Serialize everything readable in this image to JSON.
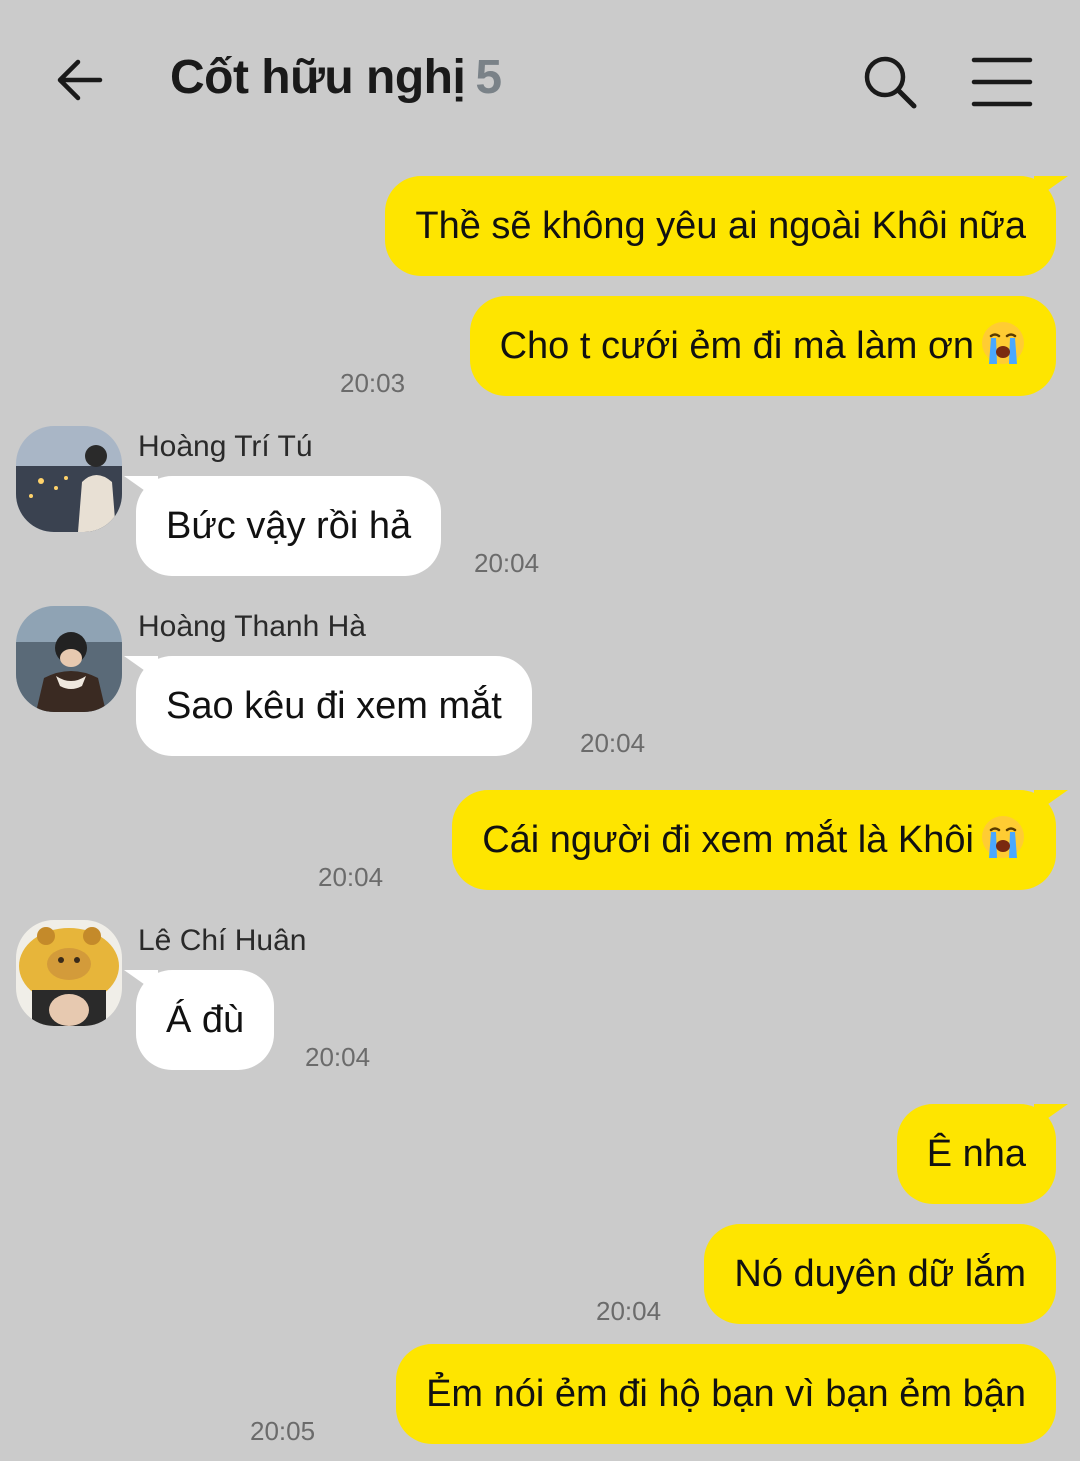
{
  "header": {
    "title": "Cốt hữu nghị",
    "member_count": "5"
  },
  "messages": [
    {
      "text": "Thề sẽ không yêu ai ngoài Khôi nữa"
    },
    {
      "text": "Cho t cưới ẻm đi mà làm ơn",
      "time": "20:03",
      "emoji": "loudly-crying-face"
    },
    {
      "sender": "Hoàng Trí Tú",
      "text": "Bức vậy rồi hả",
      "time": "20:04"
    },
    {
      "sender": "Hoàng Thanh Hà",
      "text": "Sao kêu đi xem mắt",
      "time": "20:04"
    },
    {
      "text": "Cái người đi xem mắt là Khôi",
      "time": "20:04",
      "emoji": "loudly-crying-face"
    },
    {
      "sender": "Lê Chí Huân",
      "text": "Á đù",
      "time": "20:04"
    },
    {
      "text": "Ê nha"
    },
    {
      "text": "Nó duyên dữ lắm",
      "time": "20:04"
    },
    {
      "text": "Ẻm nói ẻm đi hộ bạn vì bạn ẻm bận",
      "time": "20:05"
    }
  ],
  "colors": {
    "background": "#cbcbcb",
    "outgoing_bubble": "#fee500",
    "incoming_bubble": "#ffffff",
    "count": "#7a8288"
  }
}
